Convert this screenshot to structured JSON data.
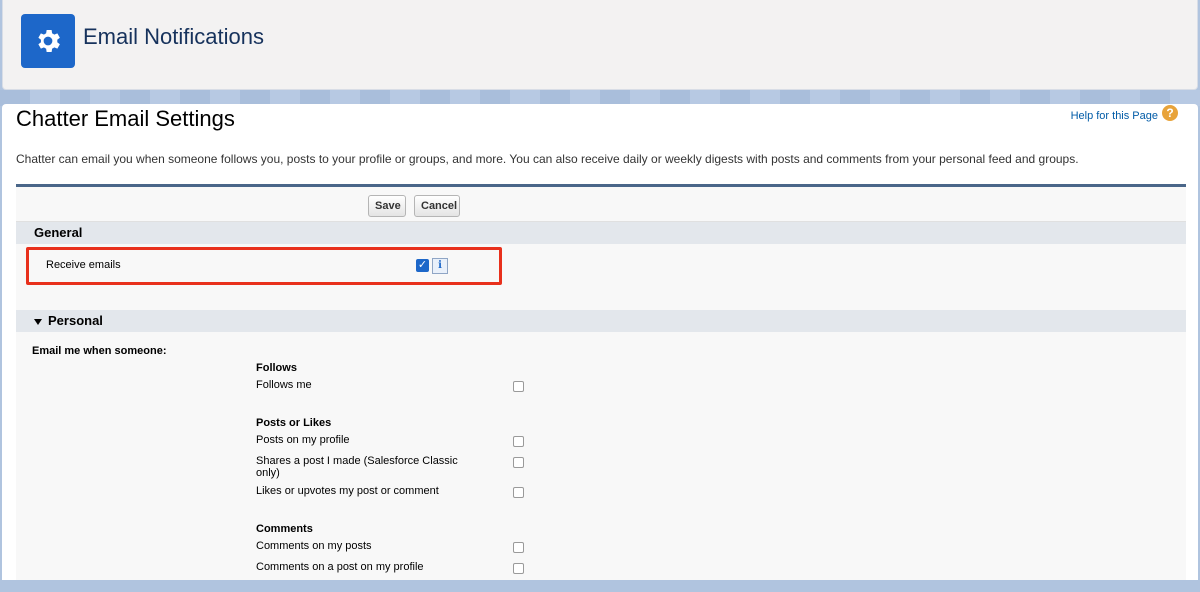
{
  "header": {
    "title": "Email Notifications",
    "icon": "gear-icon",
    "icon_color": "#1d67c9"
  },
  "page": {
    "title": "Chatter Email Settings",
    "help_link": "Help for this Page",
    "description": "Chatter can email you when someone follows you, posts to your profile or groups, and more. You can also receive daily or weekly digests with posts and comments from your personal feed and groups."
  },
  "toolbar": {
    "save_label": "Save",
    "cancel_label": "Cancel"
  },
  "general": {
    "title": "General",
    "receive_emails_label": "Receive emails",
    "receive_emails_checked": true
  },
  "personal": {
    "title": "Personal",
    "email_me_label": "Email me when someone:",
    "groups": [
      {
        "title": "Follows",
        "items": [
          {
            "label": "Follows me",
            "checked": false
          }
        ]
      },
      {
        "title": "Posts or Likes",
        "items": [
          {
            "label": "Posts on my profile",
            "checked": false
          },
          {
            "label_line1": "Shares a post I made (Salesforce Classic",
            "label_line2": "only)",
            "checked": false
          },
          {
            "label": "Likes or upvotes my post or comment",
            "checked": false
          }
        ]
      },
      {
        "title": "Comments",
        "items": [
          {
            "label": "Comments on my posts",
            "checked": false
          },
          {
            "label": "Comments on a post on my profile",
            "checked": false
          }
        ]
      }
    ]
  },
  "colors": {
    "highlight": "#e8301c",
    "section_bg": "#e3e7ec",
    "link": "#015ba7"
  }
}
